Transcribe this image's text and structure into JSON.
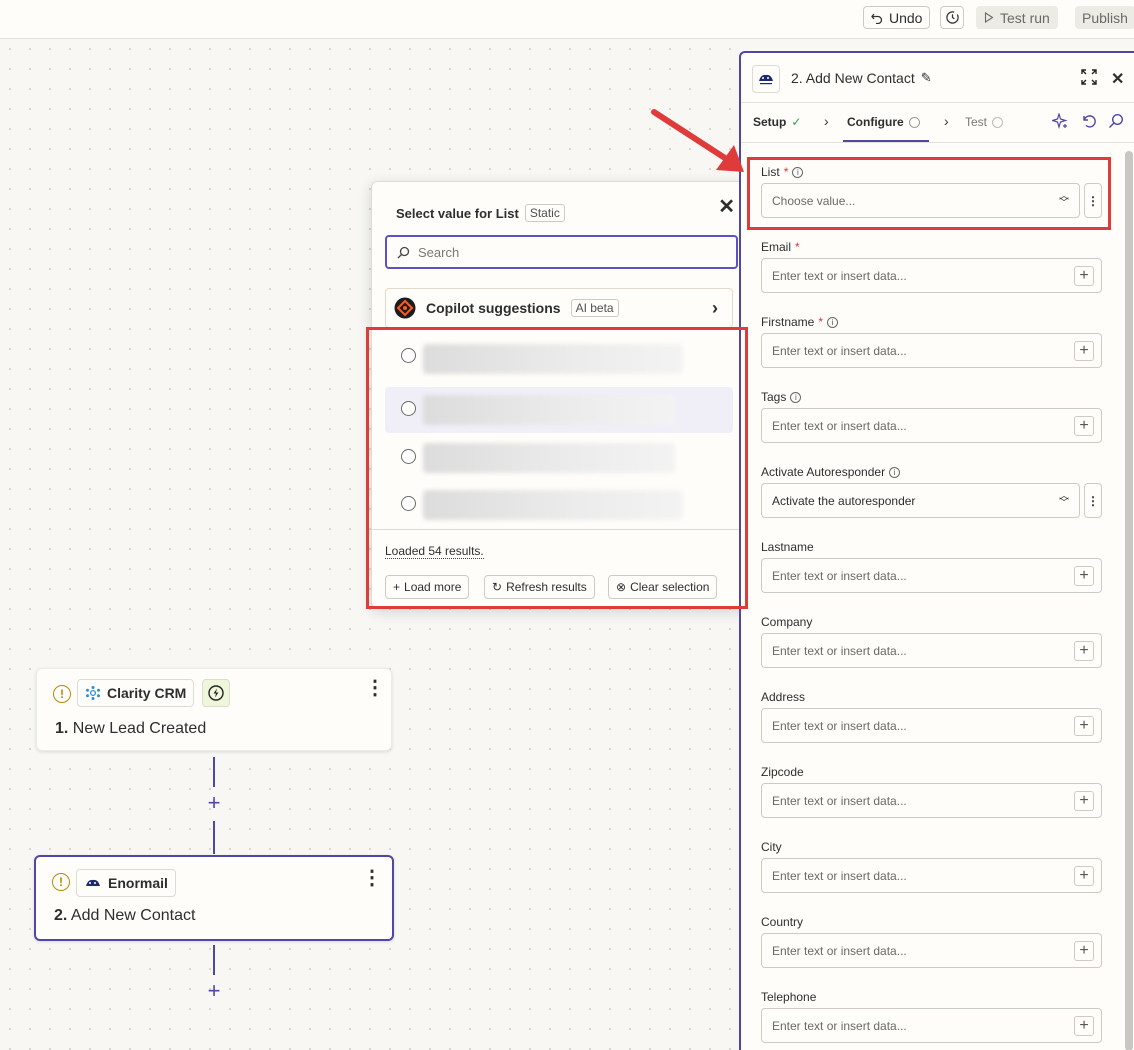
{
  "toolbar": {
    "undo_label": "Undo",
    "test_run_label": "Test run",
    "publish_label": "Publish"
  },
  "nodes": [
    {
      "app": "Clarity CRM",
      "step": "1.",
      "title": "New Lead Created"
    },
    {
      "app": "Enormail",
      "step": "2.",
      "title": "Add New Contact"
    }
  ],
  "popup": {
    "title": "Select value for List",
    "badge": "Static",
    "search_placeholder": "Search",
    "copilot_label": "Copilot suggestions",
    "copilot_badge": "AI beta",
    "loaded_text": "Loaded 54 results.",
    "load_more": "Load more",
    "refresh": "Refresh results",
    "clear": "Clear selection"
  },
  "panel": {
    "title": "2. Add New Contact",
    "tabs": [
      {
        "label": "Setup"
      },
      {
        "label": "Configure"
      },
      {
        "label": "Test"
      }
    ],
    "fields": [
      {
        "label": "List",
        "required": "*",
        "placeholder": "Choose value..."
      },
      {
        "label": "Email",
        "required": "*",
        "placeholder": "Enter text or insert data..."
      },
      {
        "label": "Firstname",
        "required": "*",
        "placeholder": "Enter text or insert data..."
      },
      {
        "label": "Tags",
        "placeholder": "Enter text or insert data..."
      },
      {
        "label": "Activate Autoresponder",
        "value": "Activate the autoresponder"
      },
      {
        "label": "Lastname",
        "placeholder": "Enter text or insert data..."
      },
      {
        "label": "Company",
        "placeholder": "Enter text or insert data..."
      },
      {
        "label": "Address",
        "placeholder": "Enter text or insert data..."
      },
      {
        "label": "Zipcode",
        "placeholder": "Enter text or insert data..."
      },
      {
        "label": "City",
        "placeholder": "Enter text or insert data..."
      },
      {
        "label": "Country",
        "placeholder": "Enter text or insert data..."
      },
      {
        "label": "Telephone",
        "placeholder": "Enter text or insert data..."
      }
    ]
  },
  "colors": {
    "accent": "#4f46a5",
    "annotation_red": "#e03b3b",
    "required": "#dd3333"
  }
}
